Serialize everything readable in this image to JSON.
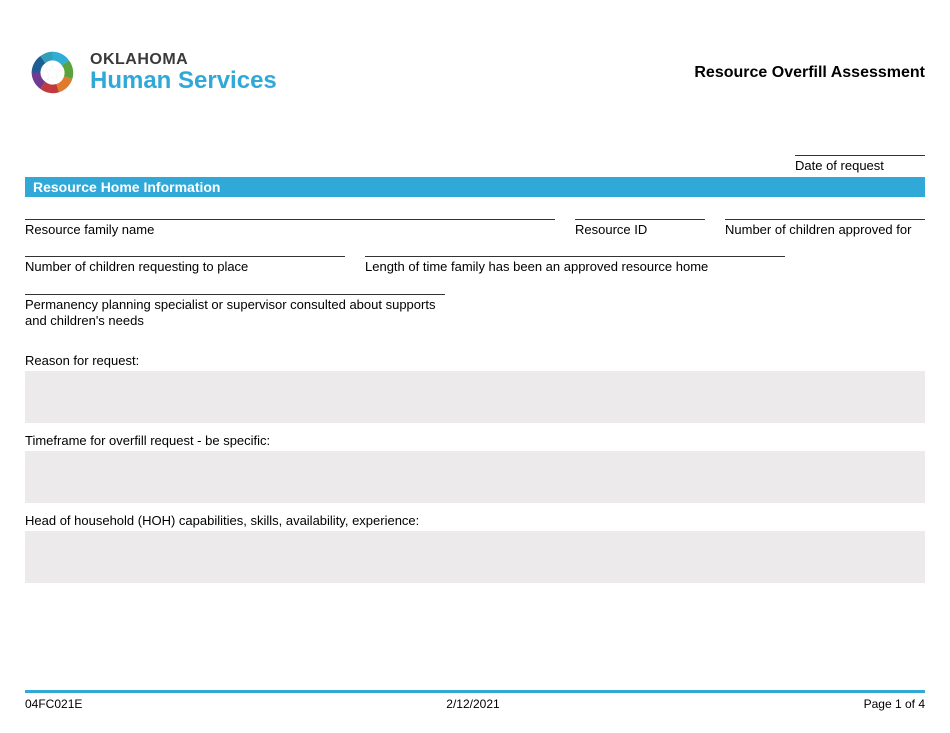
{
  "header": {
    "logo_state": "OKLAHOMA",
    "logo_dept": "Human Services",
    "doc_title": "Resource Overfill Assessment"
  },
  "date_request": {
    "label": "Date of request"
  },
  "section1": {
    "title": "Resource Home Information",
    "fields": {
      "family_name": "Resource family name",
      "resource_id": "Resource ID",
      "num_approved": "Number of children approved for",
      "num_requesting": "Number of children requesting to place",
      "length_approved": "Length of time family has been an approved resource home",
      "pps_consulted": "Permanency planning specialist or supervisor consulted about supports and children's needs"
    },
    "areas": {
      "reason": "Reason for request:",
      "timeframe": "Timeframe for overfill request - be specific:",
      "hoh": "Head of household (HOH) capabilities, skills, availability, experience:"
    }
  },
  "footer": {
    "form_id": "04FC021E",
    "date": "2/12/2021",
    "page": "Page 1 of 4"
  }
}
